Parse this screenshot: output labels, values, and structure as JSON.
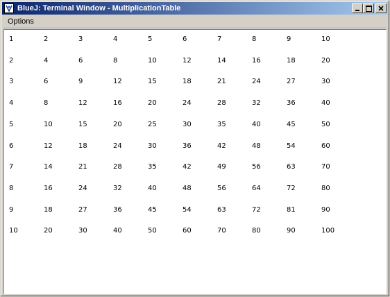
{
  "window": {
    "title": "BlueJ:  Terminal Window - MultiplicationTable",
    "app_icon": "bluej-icon",
    "controls": [
      "minimize-icon",
      "maximize-icon",
      "close-icon"
    ]
  },
  "menu": {
    "items": [
      "Options"
    ]
  },
  "terminal": {
    "rows": [
      [
        "1",
        "2",
        "3",
        "4",
        "5",
        "6",
        "7",
        "8",
        "9",
        "10"
      ],
      [
        "2",
        "4",
        "6",
        "8",
        "10",
        "12",
        "14",
        "16",
        "18",
        "20"
      ],
      [
        "3",
        "6",
        "9",
        "12",
        "15",
        "18",
        "21",
        "24",
        "27",
        "30"
      ],
      [
        "4",
        "8",
        "12",
        "16",
        "20",
        "24",
        "28",
        "32",
        "36",
        "40"
      ],
      [
        "5",
        "10",
        "15",
        "20",
        "25",
        "30",
        "35",
        "40",
        "45",
        "50"
      ],
      [
        "6",
        "12",
        "18",
        "24",
        "30",
        "36",
        "42",
        "48",
        "54",
        "60"
      ],
      [
        "7",
        "14",
        "21",
        "28",
        "35",
        "42",
        "49",
        "56",
        "63",
        "70"
      ],
      [
        "8",
        "16",
        "24",
        "32",
        "40",
        "48",
        "56",
        "64",
        "72",
        "80"
      ],
      [
        "9",
        "18",
        "27",
        "36",
        "45",
        "54",
        "63",
        "72",
        "81",
        "90"
      ],
      [
        "10",
        "20",
        "30",
        "40",
        "50",
        "60",
        "70",
        "80",
        "90",
        "100"
      ]
    ]
  }
}
